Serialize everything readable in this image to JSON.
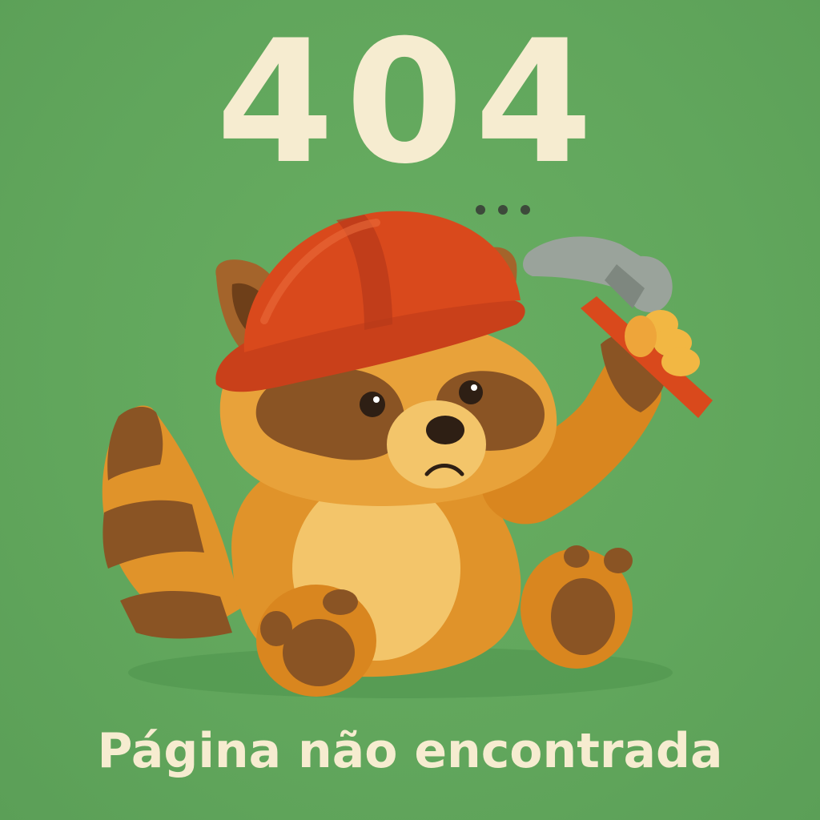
{
  "error_page": {
    "code": "404",
    "message": "Página não encontrada"
  },
  "mascot": {
    "icon": "raccoon-construction-worker-icon",
    "props": [
      "hard-hat-icon",
      "hammer-icon"
    ]
  },
  "colors": {
    "background": "#62a85e",
    "text": "#f6ecd0",
    "fur": "#e0932a",
    "fur_dark": "#8a5424",
    "helmet": "#d9491c",
    "hammer_head": "#9aa39b"
  }
}
